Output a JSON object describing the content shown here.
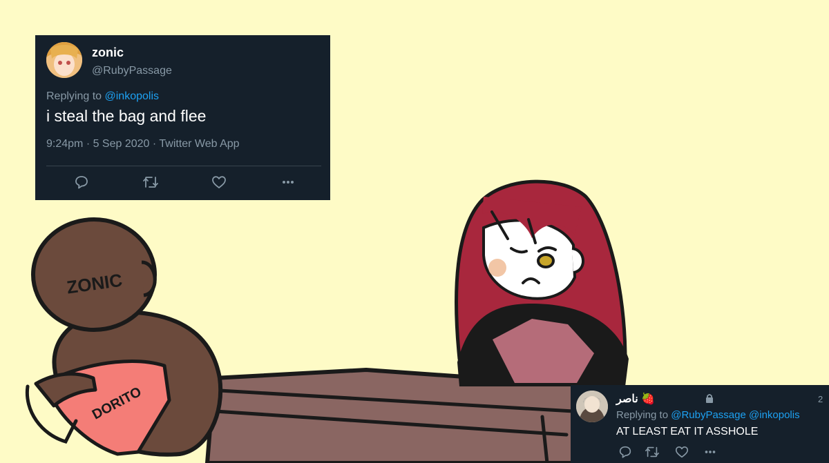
{
  "tweet_top": {
    "display_name": "zonic",
    "handle": "@RubyPassage",
    "replying_prefix": "Replying to ",
    "replying_to": "@inkopolis",
    "text": "i steal the bag and flee",
    "meta": "9:24pm · 5 Sep 2020 · Twitter Web App",
    "actions": [
      "reply-icon",
      "retweet-icon",
      "like-icon",
      "more-icon"
    ]
  },
  "tweet_bottom": {
    "display_name": "ناصر 🍓",
    "time_fragment": "2",
    "replying_prefix": "Replying to ",
    "replying_to": "@RubyPassage @inkopolis",
    "text": "AT LEAST EAT IT ASSHOLE",
    "actions": [
      "reply-icon",
      "retweet-icon",
      "like-icon",
      "more-icon"
    ]
  },
  "drawing": {
    "head_label": "ZONIC",
    "bag_label": "DORITO"
  },
  "colors": {
    "background": "#fefbc6",
    "tweet_bg": "#15202b",
    "link": "#1da1f2",
    "muted": "#8899a6",
    "figure": "#6b4a3c",
    "table": "#8a6662",
    "hair": "#a8273d",
    "bag": "#f47d77"
  }
}
